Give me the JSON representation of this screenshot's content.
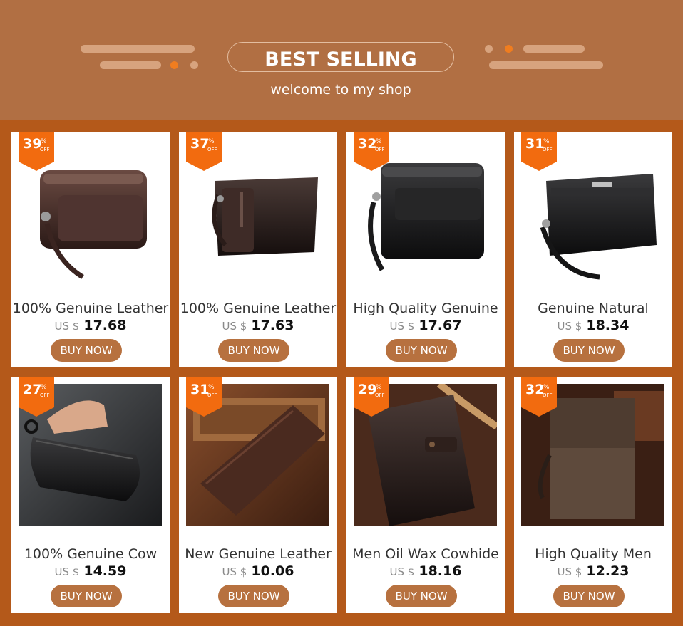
{
  "header": {
    "title": "BEST SELLING",
    "subtitle": "welcome to my shop"
  },
  "colors": {
    "background": "#b4591a",
    "header": "#b16f43",
    "badge": "#f26b0f",
    "button": "#b7713f"
  },
  "products": [
    {
      "discount": "39",
      "percent": "%",
      "off": "OFF",
      "name": "100% Genuine Leather",
      "currency": "US $",
      "price": "17.68",
      "button": "BUY NOW",
      "image": "brown-leather-clutch-wristlet"
    },
    {
      "discount": "37",
      "percent": "%",
      "off": "OFF",
      "name": "100% Genuine Leather",
      "currency": "US $",
      "price": "17.63",
      "button": "BUY NOW",
      "image": "dark-brown-leather-clutch-zipper"
    },
    {
      "discount": "32",
      "percent": "%",
      "off": "OFF",
      "name": "High Quality Genuine",
      "currency": "US $",
      "price": "17.67",
      "button": "BUY NOW",
      "image": "black-leather-clutch-wristlet"
    },
    {
      "discount": "31",
      "percent": "%",
      "off": "OFF",
      "name": "Genuine Natural",
      "currency": "US $",
      "price": "18.34",
      "button": "BUY NOW",
      "image": "black-leather-clutch-strap"
    },
    {
      "discount": "27",
      "percent": "%",
      "off": "OFF",
      "name": "100% Genuine Cow",
      "currency": "US $",
      "price": "14.59",
      "button": "BUY NOW",
      "image": "black-clutch-in-hand"
    },
    {
      "discount": "31",
      "percent": "%",
      "off": "OFF",
      "name": "New Genuine Leather",
      "currency": "US $",
      "price": "10.06",
      "button": "BUY NOW",
      "image": "brown-long-wallet-on-wood"
    },
    {
      "discount": "29",
      "percent": "%",
      "off": "OFF",
      "name": "Men Oil Wax Cowhide",
      "currency": "US $",
      "price": "18.16",
      "button": "BUY NOW",
      "image": "dark-long-wallet-with-rope"
    },
    {
      "discount": "32",
      "percent": "%",
      "off": "OFF",
      "name": "High Quality Men",
      "currency": "US $",
      "price": "12.23",
      "button": "BUY NOW",
      "image": "grey-brown-long-wallet-wristlet"
    }
  ]
}
